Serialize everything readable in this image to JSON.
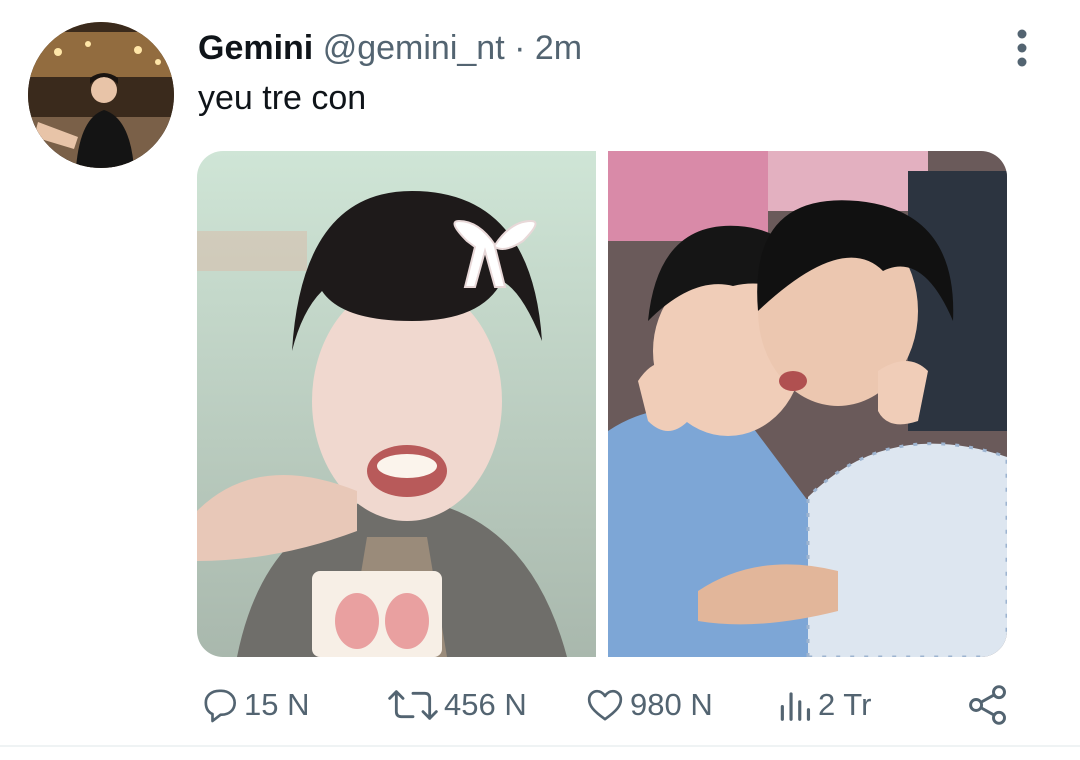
{
  "tweet": {
    "author_name": "Gemini",
    "handle": "@gemini_nt",
    "separator": "·",
    "time": "2m",
    "text": "yeu tre con"
  },
  "media": [
    {
      "name": "photo-eating-cake",
      "icon": "photo"
    },
    {
      "name": "photo-with-child",
      "icon": "photo"
    }
  ],
  "actions": {
    "reply_count": "15 N",
    "retweet_count": "456 N",
    "like_count": "980 N",
    "views_count": "2 Tr"
  },
  "icons": {
    "reply": "reply-icon",
    "retweet": "retweet-icon",
    "like": "heart-icon",
    "views": "views-icon",
    "share": "share-icon",
    "more": "more-vertical-icon"
  },
  "colors": {
    "text_primary": "#0f1419",
    "text_secondary": "#536471",
    "divider": "#eff3f4"
  }
}
